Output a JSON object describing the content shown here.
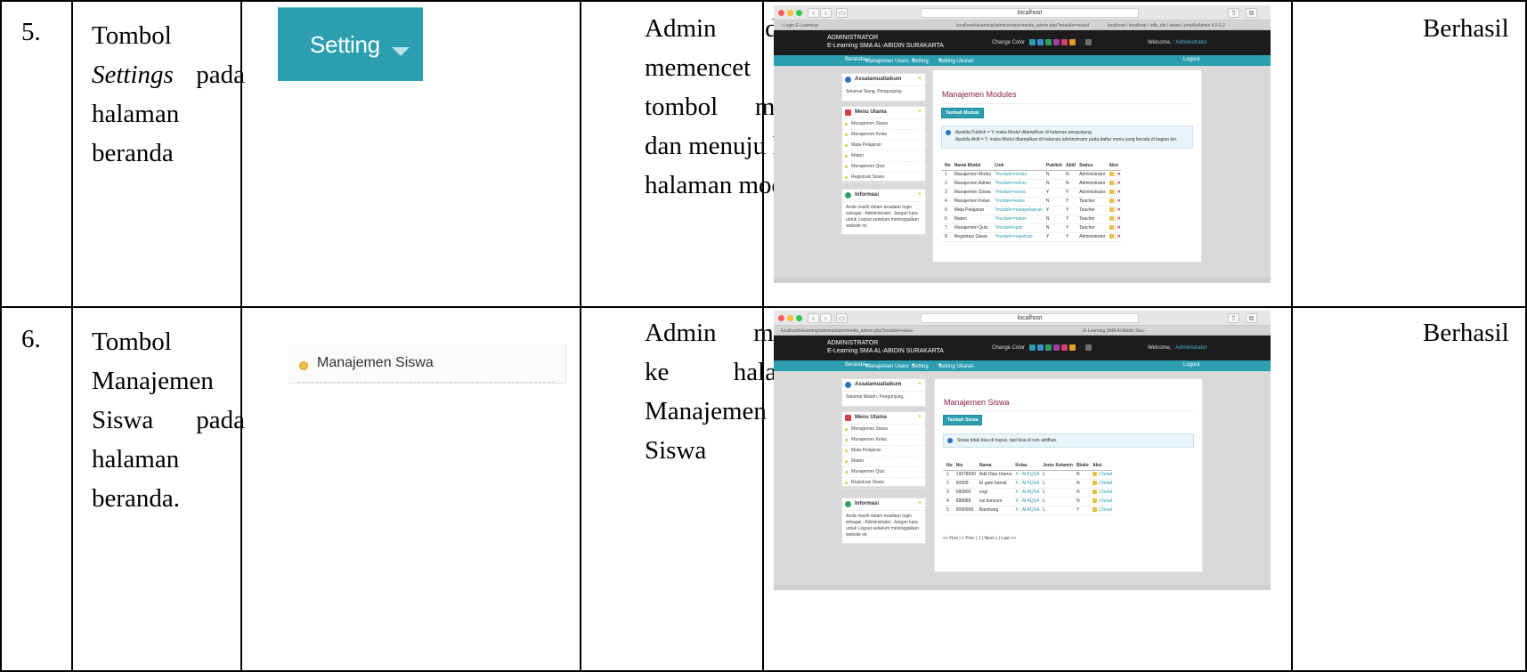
{
  "rows": [
    {
      "number": "5.",
      "feature_lines": [
        "Tombol",
        "Settings pada",
        "halaman",
        "beranda"
      ],
      "feature_italic_word": "Settings",
      "crop": {
        "button_label": "Setting"
      },
      "expected_lines": [
        "Admin dapat",
        "memencet",
        "tombol modul",
        "dan menuju ke",
        "halaman modul"
      ],
      "result": "Berhasil",
      "screenshot": {
        "url": "localhost",
        "tabs": [
          "::Login E-Learning::",
          "localhost/elearning/administrator/media_admin.php?module=modul",
          "localhost / localhost / sdb_cbt / siswa | phpMyAdmin 4.0.0.2"
        ],
        "header_line1": "ADMINISTRATOR",
        "header_line2": "E-Learning SMA AL-ABIDIN SURAKARTA",
        "change_color": "Change Color",
        "welcome": "Welcome,",
        "welcome_user": "Administrator",
        "nav": [
          "Beranda",
          "Manajemen Users",
          "Setting",
          "Setting Ukuran"
        ],
        "logout": "Logout",
        "greet_title": "Assalamuallaikum",
        "greet_text": "Selamat Siang, Pengunjung.",
        "menu_title": "Menu Utama",
        "menu_items": [
          "Manajemen Siswa",
          "Manajemen Kelas",
          "Mata Pelajaran",
          "Materi",
          "Manajemen Quiz",
          "Registrasi Siswa"
        ],
        "info_title": "Informasi",
        "info_text": "Anda masih dalam keadaan login sebagai : Administrator. Jangan lupa untuk Logout sebelum meninggalkan website ini.",
        "content_title": "Manajemen Modules",
        "add_button": "Tambah Module",
        "notice_lines": [
          "Apabila Publish = Y, maka Modul ditampilkan di halaman pengunjung.",
          "Apabila Aktif = Y, maka Modul ditampilkan di halaman administrator pada daftar menu yang berada di bagian kiri."
        ],
        "table_headers": [
          "No",
          "Nama Modul",
          "Link",
          "Publish",
          "Aktif",
          "Status",
          "Aksi"
        ],
        "table_rows": [
          [
            "1",
            "Manajemen Modul",
            "?module=modul",
            "N",
            "N",
            "Administrator"
          ],
          [
            "2",
            "Manajemen Admin",
            "?module=admin",
            "N",
            "N",
            "Administrator"
          ],
          [
            "3",
            "Manajemen Siswa",
            "?module=siswa",
            "Y",
            "Y",
            "Administrator"
          ],
          [
            "4",
            "Manajemen Kelas",
            "?module=kelas",
            "N",
            "Y",
            "Teacher"
          ],
          [
            "5",
            "Mata Pelajaran",
            "?module=matapelajaran",
            "Y",
            "Y",
            "Teacher"
          ],
          [
            "6",
            "Materi",
            "?module=materi",
            "N",
            "Y",
            "Teacher"
          ],
          [
            "7",
            "Manajemen Quiz",
            "?module=quiz",
            "N",
            "Y",
            "Teacher"
          ],
          [
            "8",
            "Registrasi Siswa",
            "?module=registrasi",
            "Y",
            "Y",
            "Administrator"
          ]
        ]
      }
    },
    {
      "number": "6.",
      "feature_lines": [
        "Tombol",
        "Manajemen",
        "Siswa pada",
        "halaman",
        "beranda."
      ],
      "crop": {
        "menu_label": "Manajemen Siswa"
      },
      "expected_lines": [
        "Admin masuk",
        "ke halaman",
        "Manajemen",
        "Siswa"
      ],
      "result": "Berhasil",
      "screenshot": {
        "url": "localhost",
        "tabs": [
          "localhost/elearning/administrator/media_admin.php?module=siswa",
          "::E-Learning SMA Al Abidin Ska::"
        ],
        "header_line1": "ADMINISTRATOR",
        "header_line2": "E-Learning SMA AL-ABIDIN SURAKARTA",
        "change_color": "Change Color",
        "welcome": "Welcome,",
        "welcome_user": "Administrator",
        "nav": [
          "Beranda",
          "Manajemen Users",
          "Setting",
          "Setting Ukuran"
        ],
        "logout": "Logout",
        "greet_title": "Assalamuallaikum",
        "greet_text": "Selamat Malam, Pengunjung.",
        "menu_title": "Menu Utama",
        "menu_items": [
          "Manajemen Siswa",
          "Manajemen Kelas",
          "Mata Pelajaran",
          "Materi",
          "Manajemen Quiz",
          "Registrasi Siswa"
        ],
        "info_title": "Informasi",
        "info_text": "Anda masih dalam keadaan login sebagai : Administrator. Jangan lupa untuk Logout sebelum meninggalkan website ini.",
        "content_title": "Manajemen Siswa",
        "add_button": "Tambah Siswa",
        "notice_lines": [
          "Siswa tidak bisa di hapus, tapi bisa di non aktifkan."
        ],
        "table_headers": [
          "No",
          "Nis",
          "Nama",
          "Kelas",
          "Jenis Kelamin",
          "Blokir",
          "Aksi"
        ],
        "table_rows": [
          [
            "1",
            "19978699",
            "Adit Dipa Utama",
            "X - Al AQSA",
            "L",
            "N"
          ],
          [
            "2",
            "90909",
            "El gato hamid",
            "X - Al AQSA",
            "L",
            "N"
          ],
          [
            "3",
            "080800",
            "yogi",
            "X - Al AQSA",
            "L",
            "N"
          ],
          [
            "4",
            "888888",
            "esi kuncoro",
            "X - Al AQSA",
            "L",
            "N"
          ],
          [
            "5",
            "9090909",
            "Bambang",
            "X - Al AQSA",
            "L",
            "Y"
          ]
        ],
        "detail_label": "Detail",
        "pager": "<< First | < Prev | 1 | Next > | Last >>"
      }
    }
  ],
  "colors": {
    "teal": "#2b9fb0",
    "dark_header": "#1c1c1c",
    "title_red": "#8a2040",
    "swatches": [
      "#2b9fb0",
      "#3a8fd0",
      "#2ea060",
      "#a040a0",
      "#d04070",
      "#e0a020",
      "#202020",
      "#707070"
    ]
  }
}
